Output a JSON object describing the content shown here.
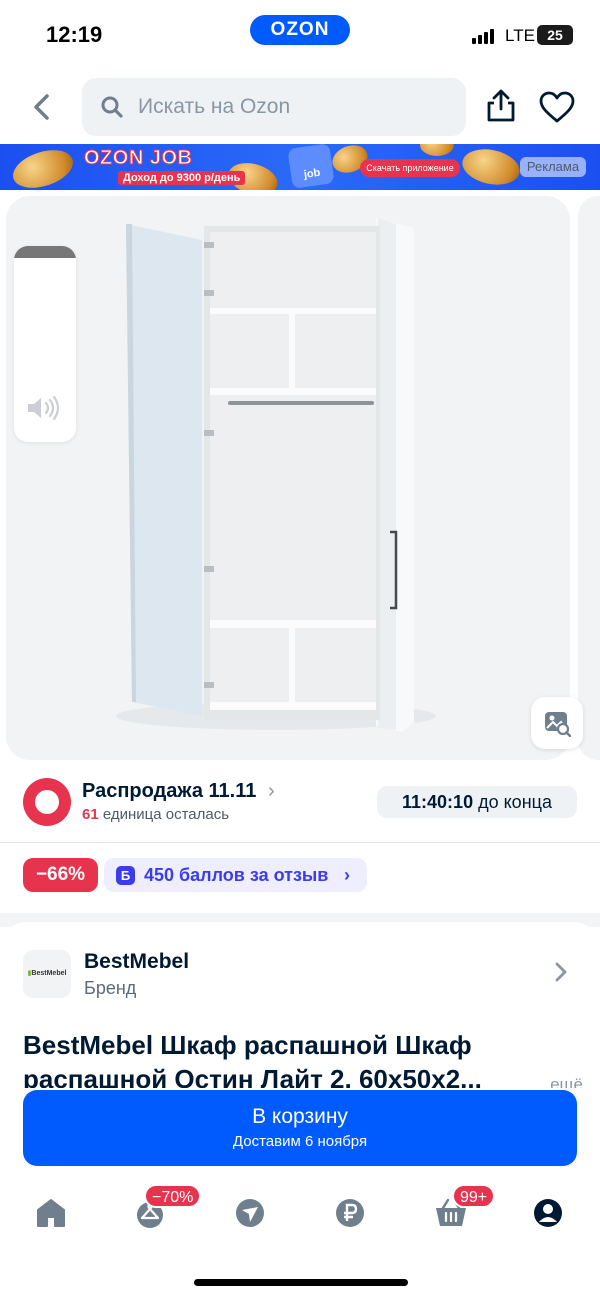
{
  "status_bar": {
    "time": "12:19",
    "app_pill": "OZON",
    "network": "LTE",
    "battery": "25"
  },
  "header": {
    "back_icon": "chevron-left-icon",
    "search_placeholder": "Искать на Ozon",
    "share_icon": "share-icon",
    "favorite_icon": "heart-icon"
  },
  "ad_banner": {
    "brand": "OZON JOB",
    "tagline": "Доход до 9300 р/день",
    "card_label": "job",
    "cta": "Скачать приложение",
    "ad_label": "Реклама"
  },
  "gallery": {
    "sound_icon": "sound-icon",
    "photo_search_icon": "photo-search-icon"
  },
  "sale": {
    "title": "Распродажа 11.11",
    "chevron": "›",
    "stock_count": "61",
    "stock_text": "единица осталась",
    "timer_value": "11:40:10",
    "timer_suffix": "до конца"
  },
  "badges": {
    "discount": "−66%",
    "points_icon": "Б",
    "points_text": "450 баллов за отзыв",
    "points_arrow": "›"
  },
  "brand": {
    "logo_text_a": "BestMebel",
    "name": "BestMebel",
    "subtitle": "Бренд"
  },
  "product": {
    "title_line1": "BestMebel Шкаф распашной Шкаф",
    "title_line2": "распашной Остин Лайт 2, 60х50х2...",
    "more": "ещё"
  },
  "cart": {
    "label": "В корзину",
    "delivery": "Доставим 6 ноября"
  },
  "tabbar": {
    "items": [
      {
        "name": "home",
        "icon": "home-icon",
        "badge": ""
      },
      {
        "name": "fresh",
        "icon": "hanger-icon",
        "badge": "−70%"
      },
      {
        "name": "pay",
        "icon": "compass-icon",
        "badge": ""
      },
      {
        "name": "ruble",
        "icon": "ruble-icon",
        "badge": ""
      },
      {
        "name": "cart",
        "icon": "cart-icon",
        "badge": "99+"
      },
      {
        "name": "profile",
        "icon": "profile-icon",
        "badge": ""
      }
    ]
  },
  "colors": {
    "brand_blue": "#005bff",
    "sale_red": "#e8334f",
    "points_purple": "#3b3bf0"
  }
}
